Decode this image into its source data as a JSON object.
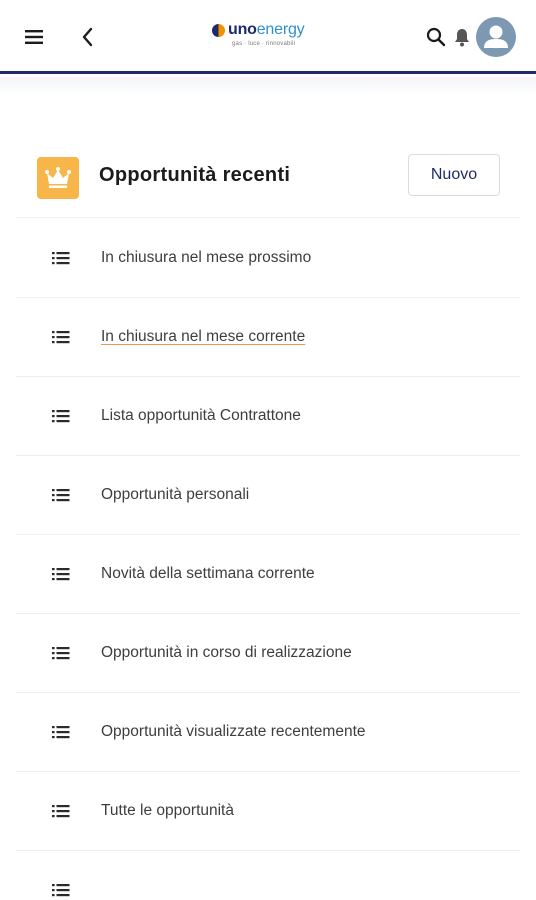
{
  "header": {
    "logo_brand_bold": "uno",
    "logo_brand_light": "energy",
    "logo_tagline": "gas · luce · rinnovabili",
    "colors": {
      "bar_border": "#1f2a6b",
      "brand_blue": "#2f8fd0",
      "brand_orange": "#f39200"
    },
    "icons": [
      "menu-icon",
      "back-chevron-icon",
      "search-icon",
      "bell-icon",
      "avatar-person-icon"
    ]
  },
  "card": {
    "title": "Opportunità recenti",
    "icon": "crown-icon",
    "icon_color": "#f7b54a",
    "new_button_label": "Nuovo"
  },
  "list": {
    "item_icon": "list-icon",
    "items": [
      {
        "label": "In chiusura nel mese prossimo"
      },
      {
        "label": "In chiusura nel mese corrente"
      },
      {
        "label": "Lista opportunità Contrattone"
      },
      {
        "label": "Opportunità personali"
      },
      {
        "label": "Novità della settimana corrente"
      },
      {
        "label": "Opportunità in corso di realizzazione"
      },
      {
        "label": "Opportunità visualizzate recentemente"
      },
      {
        "label": "Tutte le opportunità"
      },
      {
        "label": ""
      }
    ]
  }
}
